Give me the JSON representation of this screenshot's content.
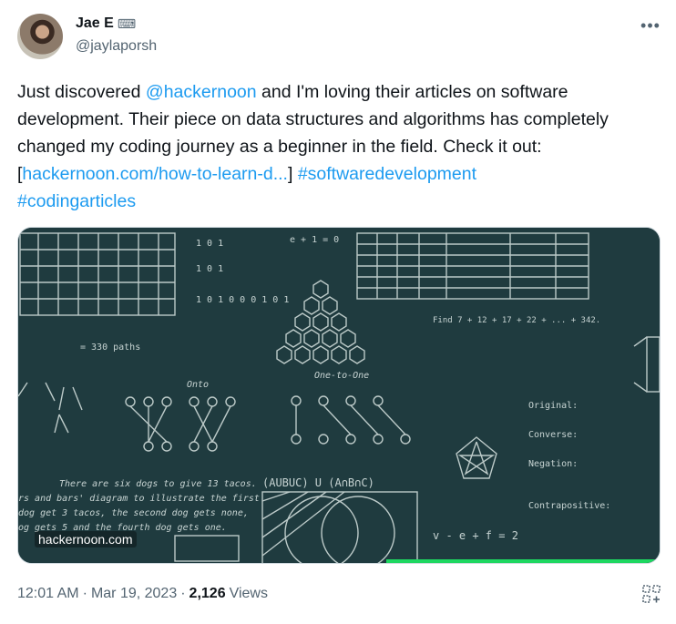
{
  "author": {
    "display_name": "Jae E",
    "handle": "@jaylaporsh",
    "name_icon": "keyboard-icon"
  },
  "tweet": {
    "part1": "Just discovered ",
    "mention": "@hackernoon",
    "part2": " and I'm loving their articles on software development. Their piece on data structures and algorithms has completely changed my coding journey as a beginner in the field. Check it out: [",
    "link": "hackernoon.com/how-to-learn-d...",
    "part3": "] ",
    "hashtag1": "#softwaredevelopment",
    "hashtag2": "#codingarticles"
  },
  "media": {
    "watermark": "hackernoon.com",
    "board_texts": {
      "t101": "1 0 1",
      "t101b": "1 0 1",
      "t101000101": "1 0 1 0 0 0 1 0 1",
      "euler": "e + 1 = 0",
      "find": "Find 7 + 12 + 17 + 22 + ... + 342.",
      "onto": "Onto",
      "one_to_one": "One-to-One",
      "paths": "= 330 paths",
      "original": "Original:",
      "converse": "Converse:",
      "negation": "Negation:",
      "contrapositive": "Contrapositive:",
      "tacos": "There are six dogs to give 13 tacos.",
      "stars_bars": "rs and bars' diagram to illustrate the first",
      "dog_line1": "dog get 3 tacos, the second dog gets none,",
      "dog_line2": "og gets 5 and the fourth dog gets one.",
      "union": "(AUBUC) U (A∩B∩C)",
      "vef": "v - e + f = 2"
    }
  },
  "meta": {
    "time": "12:01 AM",
    "date": "Mar 19, 2023",
    "views_count": "2,126",
    "views_label": "Views",
    "separator": "·"
  },
  "colors": {
    "accent": "#1d9bf0",
    "chalkboard": "#1f3b3f",
    "progress": "#1ed760"
  }
}
